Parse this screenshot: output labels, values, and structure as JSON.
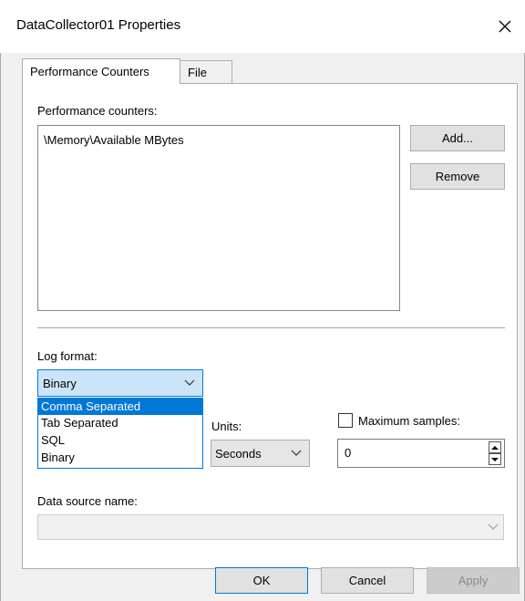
{
  "window": {
    "title": "DataCollector01 Properties"
  },
  "tabs": [
    {
      "label": "Performance Counters",
      "active": true
    },
    {
      "label": "File",
      "active": false
    }
  ],
  "counters": {
    "label": "Performance counters:",
    "items": [
      "\\Memory\\Available MBytes"
    ],
    "add_label": "Add...",
    "remove_label": "Remove"
  },
  "log_format": {
    "label": "Log format:",
    "value": "Binary",
    "options": [
      "Comma Separated",
      "Tab Separated",
      "SQL",
      "Binary"
    ],
    "highlighted": "Comma Separated"
  },
  "units": {
    "label": "Units:",
    "value": "Seconds"
  },
  "max_samples": {
    "label": "Maximum samples:",
    "checked": false,
    "value": "0"
  },
  "data_source": {
    "label": "Data source name:",
    "value": ""
  },
  "buttons": {
    "ok": "OK",
    "cancel": "Cancel",
    "apply": "Apply"
  },
  "colors": {
    "accent": "#0078d7",
    "selection_bg": "#cce4f7"
  }
}
